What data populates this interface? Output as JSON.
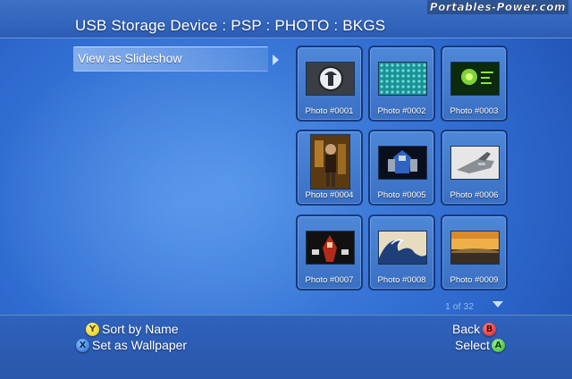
{
  "header": {
    "title": "USB Storage Device : PSP : PHOTO : BKGS",
    "watermark": "Portables-Power.com"
  },
  "menu": {
    "items": [
      {
        "label": "View as Slideshow",
        "icon": "chevron-right-icon"
      }
    ]
  },
  "photos": [
    {
      "label": "Photo #0001"
    },
    {
      "label": "Photo #0002"
    },
    {
      "label": "Photo #0003"
    },
    {
      "label": "Photo #0004"
    },
    {
      "label": "Photo #0005"
    },
    {
      "label": "Photo #0006"
    },
    {
      "label": "Photo #0007"
    },
    {
      "label": "Photo #0008"
    },
    {
      "label": "Photo #0009"
    }
  ],
  "pagination": {
    "text": "1 of 32",
    "icon": "chevron-down-icon"
  },
  "controls": {
    "sort": {
      "button": "Y",
      "label": "Sort by Name",
      "color": "#e7c400"
    },
    "wallpaper": {
      "button": "X",
      "label": "Set as Wallpaper",
      "color": "#1e63c9"
    },
    "back": {
      "button": "B",
      "label": "Back",
      "color": "#d01818"
    },
    "select": {
      "button": "A",
      "label": "Select",
      "color": "#2fae25"
    }
  }
}
